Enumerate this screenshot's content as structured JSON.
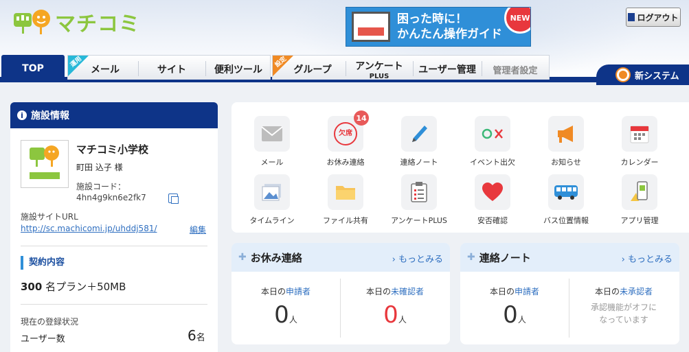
{
  "header": {
    "logo_text": "マチコミ",
    "banner": {
      "line1": "困った時に！",
      "line2": "かんたん操作ガイド",
      "badge": "NEW"
    },
    "logout_label": "ログアウト"
  },
  "nav": {
    "top_tab": "TOP",
    "group1_corner": "運用",
    "group1_tabs": [
      "メール",
      "サイト",
      "便利ツール"
    ],
    "group2_corner": "設定",
    "group2_tabs": [
      "グループ",
      "アンケート",
      "ユーザー管理",
      "管理者設定"
    ],
    "survey_sub": "PLUS",
    "new_system": "新システム"
  },
  "facility": {
    "title": "施設情報",
    "school_name": "マチコミ小学校",
    "person": "町田 込子 様",
    "code_label": "施設コード：",
    "code_value": "4hn4g9kn6e2fk7",
    "site_label": "施設サイトURL",
    "site_url": "http://sc.machicomi.jp/uhddj581/",
    "edit_label": "編集",
    "contract_title": "契約内容",
    "plan_num": "300",
    "plan_text": " 名プラン＋50MB",
    "registration_label": "現在の登録状況",
    "users_label": "ユーザー数",
    "users_count": "6",
    "users_unit": "名"
  },
  "apps": [
    {
      "label": "メール",
      "icon": "mail-icon"
    },
    {
      "label": "お休み連絡",
      "icon": "absence-icon",
      "badge": "14",
      "icon_text": "欠席"
    },
    {
      "label": "連絡ノート",
      "icon": "pen-icon"
    },
    {
      "label": "イベント出欠",
      "icon": "attendance-icon"
    },
    {
      "label": "お知らせ",
      "icon": "megaphone-icon"
    },
    {
      "label": "カレンダー",
      "icon": "calendar-icon"
    },
    {
      "label": "タイムライン",
      "icon": "photo-icon"
    },
    {
      "label": "ファイル共有",
      "icon": "folder-icon"
    },
    {
      "label": "アンケートPLUS",
      "icon": "clipboard-icon"
    },
    {
      "label": "安否確認",
      "icon": "heart-icon"
    },
    {
      "label": "バス位置情報",
      "icon": "bus-icon"
    },
    {
      "label": "アプリ管理",
      "icon": "phone-icon"
    }
  ],
  "cards": {
    "absence": {
      "title": "お休み連絡",
      "more": "もっとみる",
      "left_prefix": "本日の",
      "left_hl": "申請者",
      "left_value": "0",
      "right_prefix": "本日の",
      "right_hl": "未確認者",
      "right_value": "0",
      "unit": "人"
    },
    "note": {
      "title": "連絡ノート",
      "more": "もっとみる",
      "left_prefix": "本日の",
      "left_hl": "申請者",
      "left_value": "0",
      "right_prefix": "本日の",
      "right_hl": "未承認者",
      "right_note_1": "承認機能がオフに",
      "right_note_2": "なっています",
      "unit": "人"
    }
  }
}
